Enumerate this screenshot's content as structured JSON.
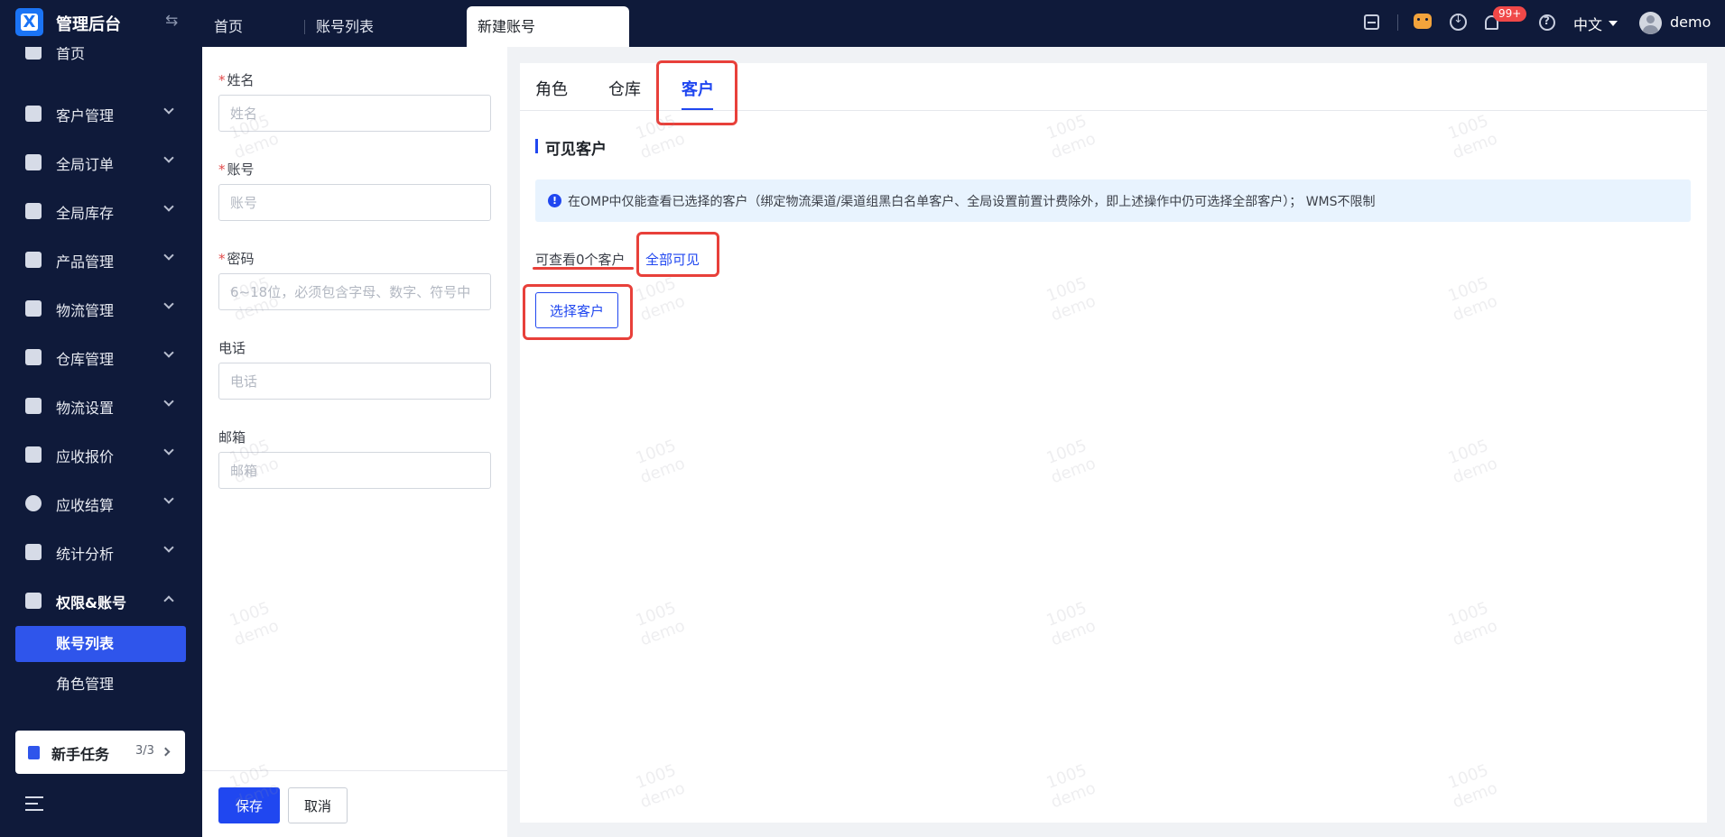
{
  "header": {
    "app_title": "管理后台",
    "tabs": [
      {
        "label": "首页"
      },
      {
        "label": "账号列表"
      },
      {
        "label": "新建账号"
      }
    ],
    "notification_badge": "99+",
    "language": "中文",
    "username": "demo"
  },
  "sidebar": {
    "items": [
      {
        "label": "首页",
        "icon": "home-icon"
      },
      {
        "label": "客户管理",
        "icon": "users-icon"
      },
      {
        "label": "全局订单",
        "icon": "clipboard-icon"
      },
      {
        "label": "全局库存",
        "icon": "warehouse-icon"
      },
      {
        "label": "产品管理",
        "icon": "bag-icon"
      },
      {
        "label": "物流管理",
        "icon": "truck-icon"
      },
      {
        "label": "仓库管理",
        "icon": "house-icon"
      },
      {
        "label": "物流设置",
        "icon": "box-settings-icon"
      },
      {
        "label": "应收报价",
        "icon": "document-icon"
      },
      {
        "label": "应收结算",
        "icon": "dollar-icon"
      },
      {
        "label": "统计分析",
        "icon": "chart-icon"
      },
      {
        "label": "权限&账号",
        "icon": "org-chart-icon"
      }
    ],
    "sub_items": [
      {
        "label": "账号列表"
      },
      {
        "label": "角色管理"
      }
    ],
    "task": {
      "label": "新手任务",
      "count": "3/3"
    }
  },
  "form": {
    "name": {
      "label": "姓名",
      "placeholder": "姓名",
      "required": "*"
    },
    "account": {
      "label": "账号",
      "placeholder": "账号",
      "required": "*"
    },
    "password": {
      "label": "密码",
      "placeholder": "6~18位，必须包含字母、数字、符号中",
      "required": "*"
    },
    "phone": {
      "label": "电话",
      "placeholder": "电话"
    },
    "email": {
      "label": "邮箱",
      "placeholder": "邮箱"
    },
    "save_label": "保存",
    "cancel_label": "取消"
  },
  "main": {
    "tabs": [
      {
        "label": "角色"
      },
      {
        "label": "仓库"
      },
      {
        "label": "客户"
      }
    ],
    "section_title": "可见客户",
    "notice_icon": "!",
    "notice": "在OMP中仅能查看已选择的客户（绑定物流渠道/渠道组黑白名单客户、全局设置前置计费除外，即上述操作中仍可选择全部客户）； WMS不限制",
    "view_count": "可查看0个客户",
    "view_all": "全部可见",
    "select_button": "选择客户"
  },
  "watermark": {
    "line1": "1005",
    "line2": "demo"
  },
  "colors": {
    "sidebar_bg": "#0f1a3a",
    "accent": "#2047f0",
    "annotation_red": "#e8403a",
    "notice_bg": "#e8f3fe"
  }
}
